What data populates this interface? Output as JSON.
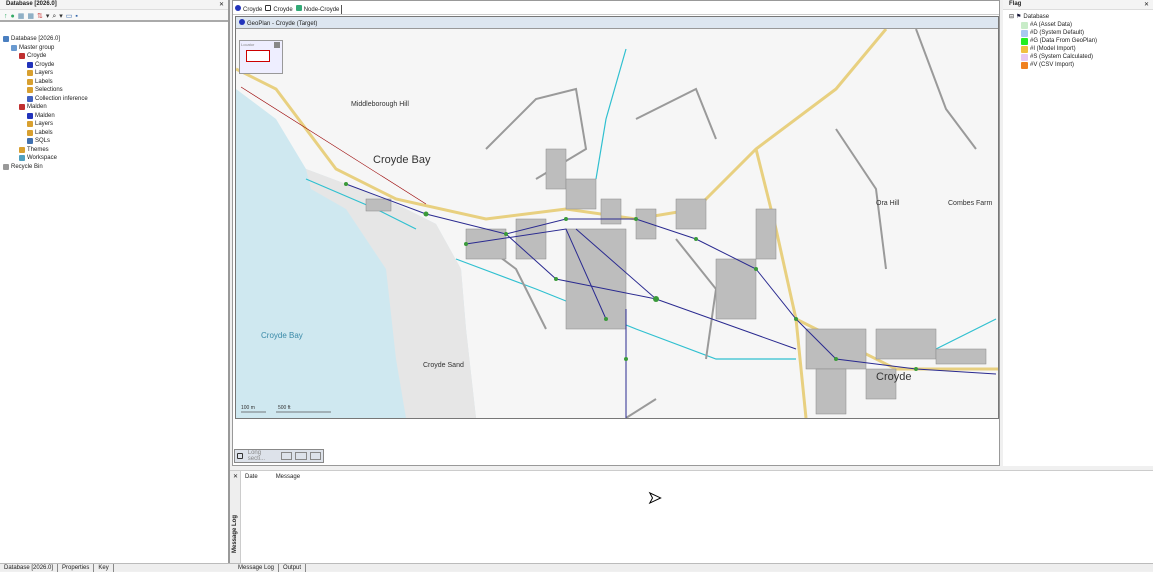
{
  "left_panel": {
    "title": "Database [2026.0]",
    "tree": [
      {
        "label": "Database [2026.0]",
        "indent": 0,
        "color": "#4a7fc0"
      },
      {
        "label": "Master group",
        "indent": 1,
        "color": "#6a9ad0"
      },
      {
        "label": "Croyde",
        "indent": 2,
        "color": "#c03030"
      },
      {
        "label": "Croyde",
        "indent": 3,
        "color": "#2233bb"
      },
      {
        "label": "Layers",
        "indent": 3,
        "color": "#d8a030"
      },
      {
        "label": "Labels",
        "indent": 3,
        "color": "#d8a030"
      },
      {
        "label": "Selections",
        "indent": 3,
        "color": "#d8a030"
      },
      {
        "label": "Collection inference",
        "indent": 3,
        "color": "#4060c0"
      },
      {
        "label": "Malden",
        "indent": 2,
        "color": "#c03030"
      },
      {
        "label": "Malden",
        "indent": 3,
        "color": "#2233bb"
      },
      {
        "label": "Layers",
        "indent": 3,
        "color": "#d8a030"
      },
      {
        "label": "Labels",
        "indent": 3,
        "color": "#d8a030"
      },
      {
        "label": "SQLs",
        "indent": 3,
        "color": "#4070b0"
      },
      {
        "label": "Themes",
        "indent": 2,
        "color": "#d8a030"
      },
      {
        "label": "Workspace",
        "indent": 2,
        "color": "#50a0c0"
      },
      {
        "label": "Recycle Bin",
        "indent": 0,
        "color": "#999999"
      }
    ],
    "bottom_tabs": [
      "Database [2026.0]",
      "Properties",
      "Key"
    ]
  },
  "doc_tabs": [
    "Croyde",
    "Croyde",
    "Node-Croyde"
  ],
  "geoplan": {
    "title": "GeoPlan - Croyde (Target)",
    "locator": "Locator",
    "scale": [
      "100 m",
      "500 ft"
    ],
    "labels": {
      "middleborough": "Middleborough Hill",
      "croyde_bay_town": "Croyde Bay",
      "ora_hill": "Ora Hill",
      "combes_farm": "Combes Farm",
      "croyde_bay_sea": "Croyde Bay",
      "croyde_sand": "Croyde Sand",
      "croyde": "Croyde"
    }
  },
  "long_section": {
    "label": "Long secti..."
  },
  "message_log": {
    "side_label": "Message Log",
    "columns": [
      "Date",
      "Message"
    ],
    "bottom_tabs": [
      "Message Log",
      "Output"
    ]
  },
  "flag_panel": {
    "title": "Flag",
    "root": "Database",
    "items": [
      {
        "label": "#A (Asset Data)",
        "color": "#c8ecc8"
      },
      {
        "label": "#D (System Default)",
        "color": "#a8c8f0"
      },
      {
        "label": "#G (Data From GeoPlan)",
        "color": "#22ee22"
      },
      {
        "label": "#I (Model Import)",
        "color": "#f0c040"
      },
      {
        "label": "#S (System Calculated)",
        "color": "#e8c8f0"
      },
      {
        "label": "#V (CSV Import)",
        "color": "#f08020"
      }
    ]
  }
}
